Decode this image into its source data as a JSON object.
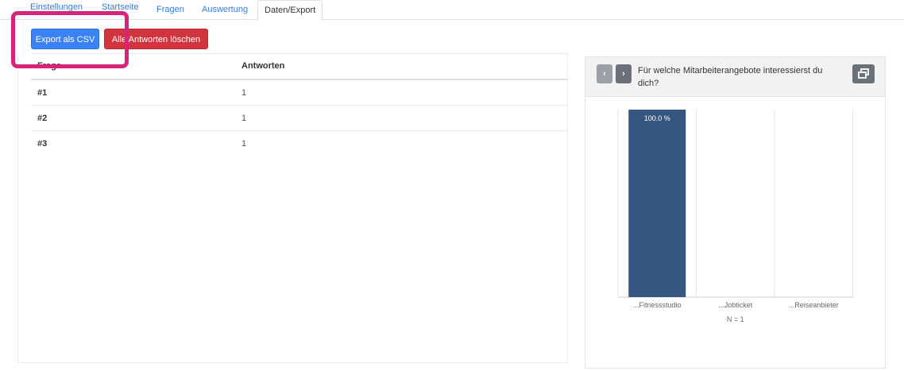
{
  "tabs": [
    {
      "label": "Einstellungen"
    },
    {
      "label": "Startseite"
    },
    {
      "label": "Fragen"
    },
    {
      "label": "Auswertung"
    },
    {
      "label": "Daten/Export"
    }
  ],
  "toolbar": {
    "export_label": "Export als CSV",
    "delete_label": "Alle Antworten löschen"
  },
  "table": {
    "headers": [
      "Frage",
      "Antworten"
    ],
    "rows": [
      {
        "frage": "#1",
        "antworten": "1"
      },
      {
        "frage": "#2",
        "antworten": "1"
      },
      {
        "frage": "#3",
        "antworten": "1"
      }
    ]
  },
  "chart_card": {
    "prev_icon": "‹",
    "next_icon": "›",
    "title": "Für welche Mitarbeiterangebote interessierst du dich?",
    "popout_icon": "window-restore-icon"
  },
  "chart_data": {
    "type": "bar",
    "categories": [
      "...Fitnessstudio",
      "...Jobticket",
      "...Reiseanbieter"
    ],
    "values": [
      100.0,
      0,
      0
    ],
    "data_labels": [
      "100.0 %",
      "",
      ""
    ],
    "ylim": [
      0,
      100
    ],
    "footer": "N = 1",
    "bar_color": "#34567f"
  },
  "colors": {
    "primary": "#3b82f6",
    "danger": "#d2343e",
    "highlight": "#d6247a",
    "link": "#3a7bd5"
  }
}
